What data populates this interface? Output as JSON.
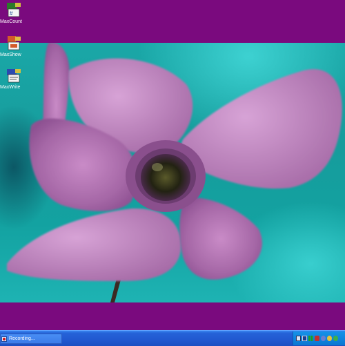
{
  "desktop": {
    "icons": [
      {
        "label": "MaxCount",
        "icon": "maxcount-app-icon"
      },
      {
        "label": "MaxShow",
        "icon": "maxshow-app-icon"
      },
      {
        "label": "MaxWrite",
        "icon": "maxwrite-app-icon"
      }
    ],
    "background_color": "#7a0a7e"
  },
  "taskbar": {
    "active_task_label": "Recording...",
    "tray_icons": [
      "display-icon",
      "network-icon",
      "volume-icon",
      "security-icon",
      "bluetooth-icon",
      "antivirus-icon",
      "update-icon"
    ]
  }
}
